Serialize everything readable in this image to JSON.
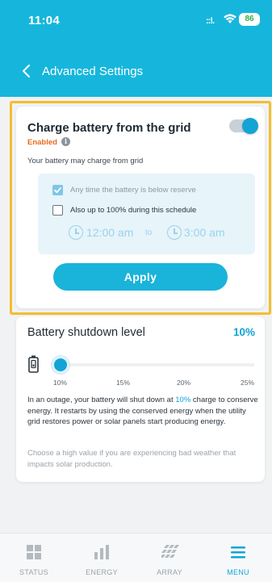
{
  "status_bar": {
    "time": "11:04",
    "signal": "::!.",
    "battery": "86"
  },
  "nav": {
    "title": "Advanced Settings"
  },
  "grid_card": {
    "title": "Charge battery from the grid",
    "toggle_on": true,
    "status": "Enabled",
    "subtitle": "Your battery may charge from grid",
    "option_1": "Any time the battery is below reserve",
    "option_1_checked": true,
    "option_2": "Also up to 100% during this schedule",
    "option_2_checked": false,
    "start_time": "12:00 am",
    "to_label": "to",
    "end_time": "3:00 am",
    "apply_label": "Apply"
  },
  "shutdown_card": {
    "title": "Battery shutdown level",
    "value": "10%",
    "slider_value_percent": 10,
    "ticks": [
      "10%",
      "15%",
      "20%",
      "25%"
    ],
    "desc_prefix": "In an outage, your battery will shut down at ",
    "desc_highlight": "10%",
    "desc_suffix": " charge to conserve energy. It restarts by using the conserved energy when the utility grid restores power or solar panels start producing energy.",
    "hint": "Choose a high value if you are experiencing bad weather that impacts solar production."
  },
  "tabs": [
    {
      "label": "STATUS",
      "active": false
    },
    {
      "label": "ENERGY",
      "active": false
    },
    {
      "label": "ARRAY",
      "active": false
    },
    {
      "label": "MENU",
      "active": true
    }
  ],
  "colors": {
    "primary": "#16b6dc",
    "accent": "#13a4d6",
    "warning": "#e86a1e",
    "highlight": "#f3be2e"
  }
}
